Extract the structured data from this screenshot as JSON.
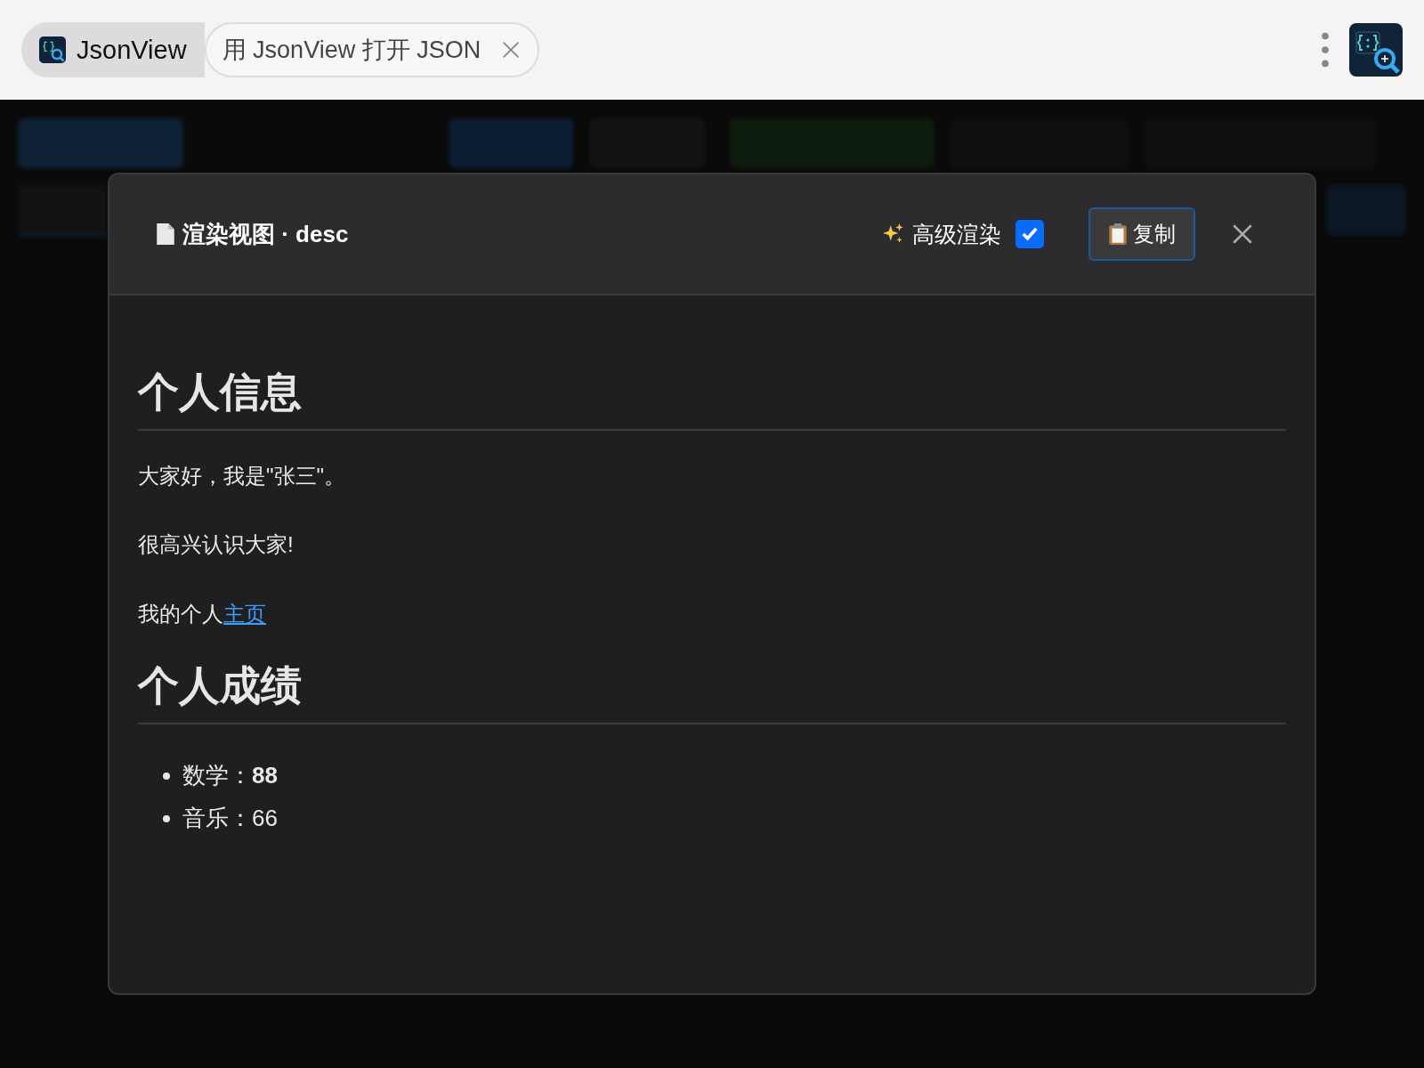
{
  "browser": {
    "tabs": [
      {
        "label": "JsonView",
        "selected": true,
        "closable": false
      },
      {
        "label": "用 JsonView 打开 JSON",
        "selected": false,
        "closable": true
      }
    ]
  },
  "modal": {
    "title": "渲染视图 · desc",
    "advanced_render": {
      "label": "高级渲染",
      "checked": true
    },
    "copy_button": "复制",
    "content": [
      {
        "kind": "heading",
        "text": "个人信息"
      },
      {
        "kind": "paragraph",
        "text": "大家好，我是\"张三\"。"
      },
      {
        "kind": "paragraph",
        "text": "很高兴认识大家!"
      },
      {
        "kind": "paragraph",
        "text": "我的个人",
        "link": "主页"
      },
      {
        "kind": "heading",
        "text": "个人成绩"
      },
      {
        "kind": "list",
        "items": [
          "数学：**88**",
          "音乐：66"
        ]
      }
    ]
  }
}
